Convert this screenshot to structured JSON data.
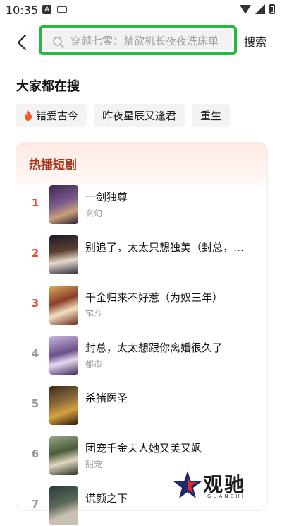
{
  "status": {
    "time": "10:35",
    "app_badge": "A"
  },
  "search": {
    "placeholder": "穿越七零：禁欲机长夜夜洗床单",
    "button_label": "搜索"
  },
  "trending": {
    "title": "大家都在搜",
    "tags": [
      "错爱古今",
      "昨夜星辰又逢君",
      "重生"
    ]
  },
  "hot_list": {
    "title": "热播短剧",
    "items": [
      {
        "rank": "1",
        "title": "一剑独尊",
        "genre": "玄幻"
      },
      {
        "rank": "2",
        "title": "别追了，太太只想独美（封总，…",
        "genre": ""
      },
      {
        "rank": "3",
        "title": "千金归来不好惹（为奴三年）",
        "genre": "宅斗"
      },
      {
        "rank": "4",
        "title": "封总，太太想跟你离婚很久了",
        "genre": "都市"
      },
      {
        "rank": "5",
        "title": "杀猪医圣",
        "genre": ""
      },
      {
        "rank": "6",
        "title": "团宠千金夫人她又美又飒",
        "genre": "甜宠"
      },
      {
        "rank": "7",
        "title": "谎颜之下",
        "genre": ""
      }
    ]
  },
  "watermark": {
    "text": "观驰",
    "sub": "GUANCHI"
  },
  "colors": {
    "accent": "#e8502a",
    "highlight_border": "#22bb3c",
    "hot_title": "#a8361a"
  }
}
